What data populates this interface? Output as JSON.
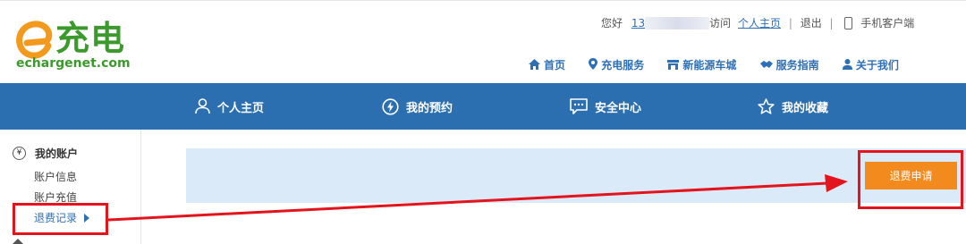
{
  "brand": {
    "name_cn": "充电",
    "domain": "echargenet.com",
    "green": "#3c9a2d"
  },
  "userbar": {
    "greeting": "您好",
    "username_visible": "13",
    "visit_suffix": "访问",
    "profile_link": "个人主页",
    "logout": "退出",
    "mobile_client": "手机客户端"
  },
  "main_nav": [
    {
      "label": "首页",
      "icon": "home-icon"
    },
    {
      "label": "充电服务",
      "icon": "location-pin-icon"
    },
    {
      "label": "新能源车城",
      "icon": "store-icon"
    },
    {
      "label": "服务指南",
      "icon": "handshake-icon"
    },
    {
      "label": "关于我们",
      "icon": "person-icon"
    }
  ],
  "tabs": [
    {
      "label": "个人主页",
      "icon": "user-icon"
    },
    {
      "label": "我的预约",
      "icon": "lightning-circle-icon"
    },
    {
      "label": "安全中心",
      "icon": "chat-bubble-icon"
    },
    {
      "label": "我的收藏",
      "icon": "star-icon"
    }
  ],
  "sidebar": {
    "section_title": "我的账户",
    "section_icon": "yen-icon",
    "yen_symbol": "¥",
    "items": [
      {
        "label": "账户信息"
      },
      {
        "label": "账户充值"
      },
      {
        "label": "退费记录",
        "active": true
      }
    ]
  },
  "content": {
    "refund_button": "退费申请"
  },
  "colors": {
    "nav_blue": "#2b6fb0",
    "link_blue": "#2f6fb5",
    "panel_bg": "#dbeaf8",
    "button_orange": "#f28a1e",
    "annotation_red": "#e3141b"
  }
}
